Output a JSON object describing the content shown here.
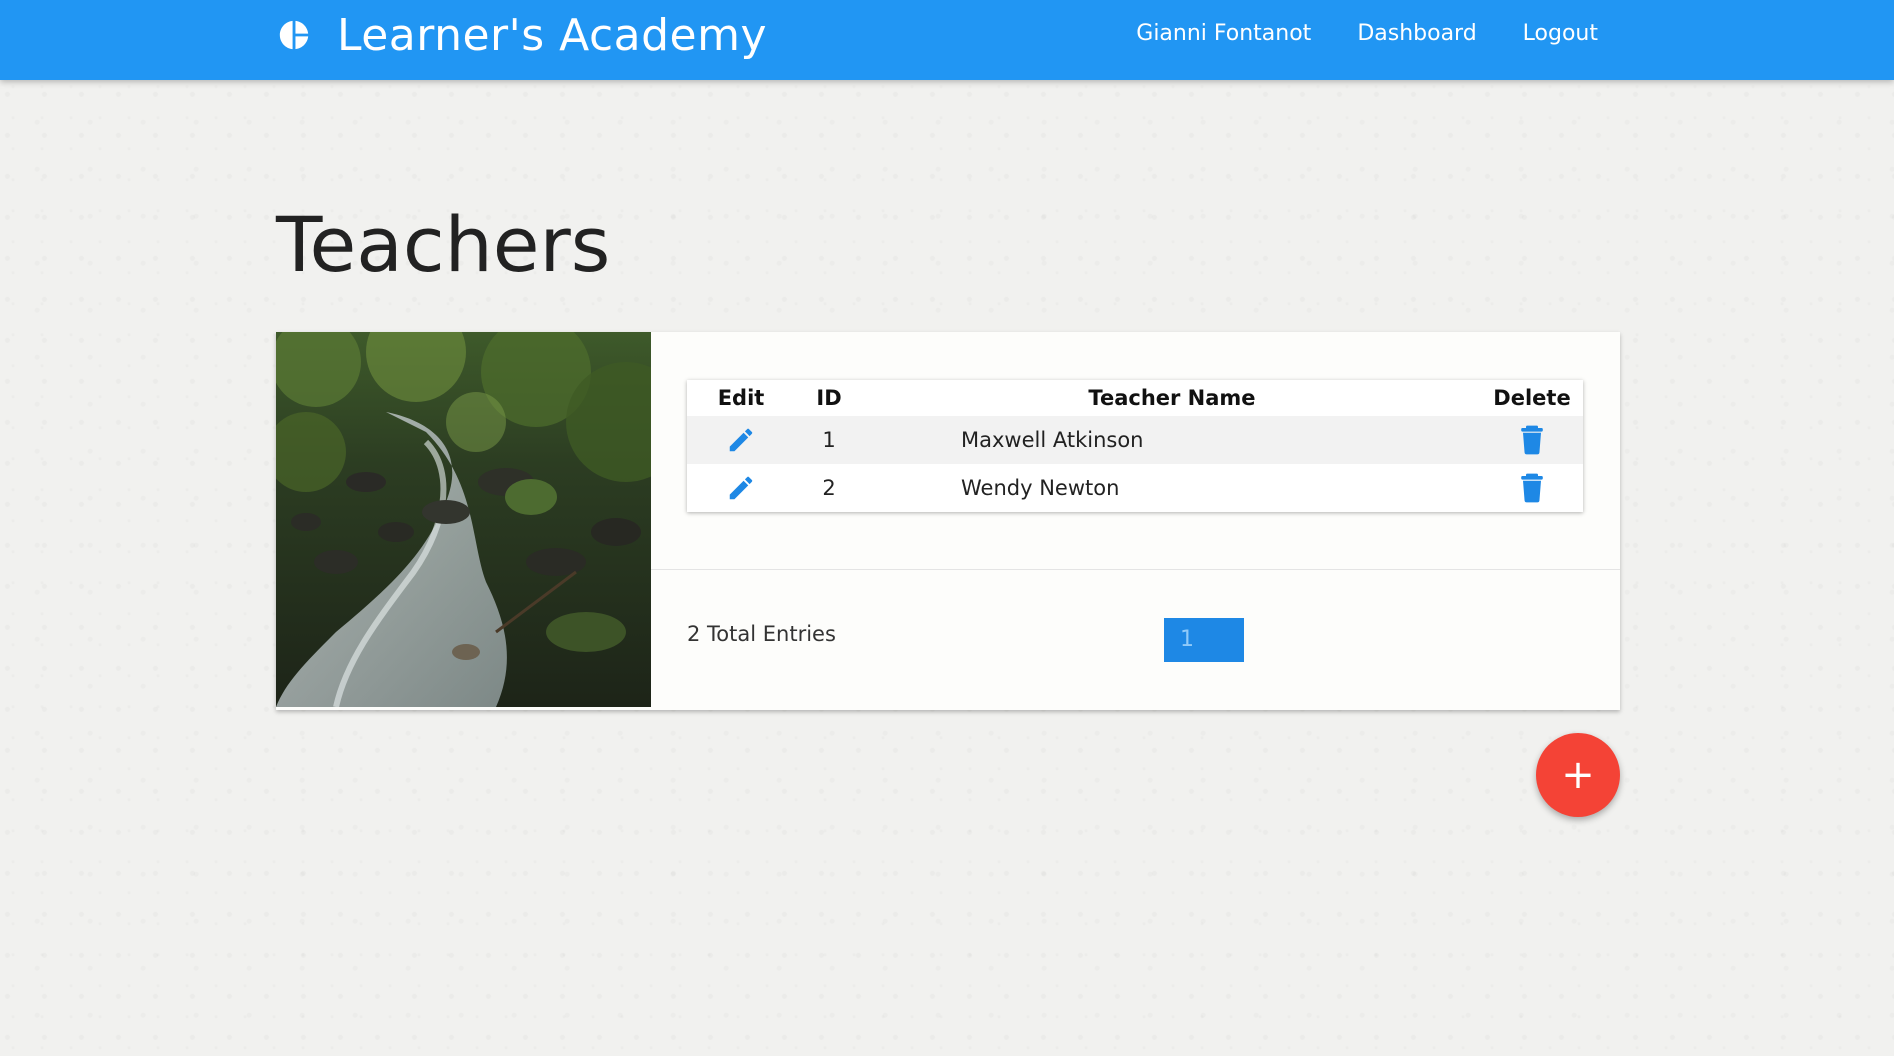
{
  "navbar": {
    "brand": "Learner's Academy",
    "brand_icon": "pie-chart-icon",
    "links": [
      "Gianni Fontanot",
      "Dashboard",
      "Logout"
    ],
    "color": "#2196f3"
  },
  "page": {
    "title": "Teachers"
  },
  "table": {
    "headers": {
      "edit": "Edit",
      "id": "ID",
      "name": "Teacher Name",
      "delete": "Delete"
    },
    "rows": [
      {
        "id": "1",
        "name": "Maxwell Atkinson"
      },
      {
        "id": "2",
        "name": "Wendy Newton"
      }
    ],
    "edit_icon": "pencil-icon",
    "delete_icon": "trash-icon",
    "icon_color": "#1e88e5"
  },
  "footer": {
    "total": "2 Total Entries",
    "current_page": "1"
  },
  "fab": {
    "label": "+",
    "color": "#f44336"
  }
}
